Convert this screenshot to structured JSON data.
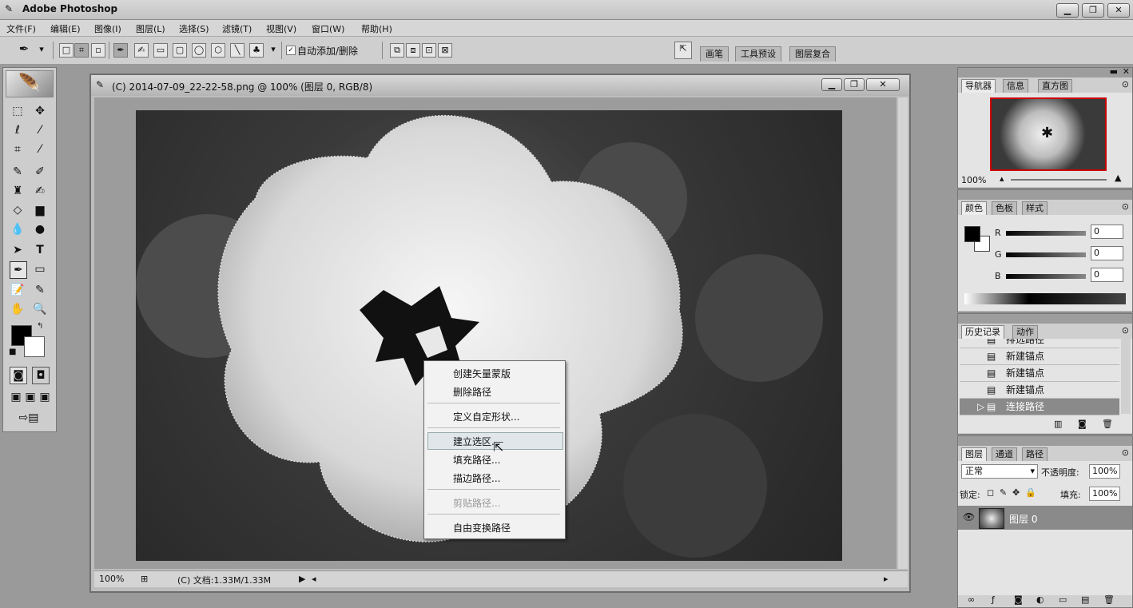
{
  "app": {
    "title": "Adobe Photoshop"
  },
  "window_buttons": {
    "minimize": "▁",
    "restore": "❐",
    "close": "✕"
  },
  "menu": [
    "文件(F)",
    "编辑(E)",
    "图像(I)",
    "图层(L)",
    "选择(S)",
    "滤镜(T)",
    "视图(V)",
    "窗口(W)",
    "帮助(H)"
  ],
  "options": {
    "auto_add_delete_label": "自动添加/删除",
    "auto_add_delete_checked": true,
    "well_tabs": [
      "画笔",
      "工具预设",
      "图层复合"
    ]
  },
  "document": {
    "title": "(C) 2014-07-09_22-22-58.png @ 100% (图层 0, RGB/8)",
    "zoom": "100%",
    "doc_info": "(C) 文档:1.33M/1.33M"
  },
  "context_menu": {
    "items": [
      "创建矢量蒙版",
      "删除路径",
      "定义自定形状...",
      "建立选区...",
      "填充路径...",
      "描边路径...",
      "剪贴路径...",
      "自由变换路径"
    ],
    "highlighted": "建立选区...",
    "disabled": "剪贴路径..."
  },
  "navigator": {
    "tabs": [
      "导航器",
      "信息",
      "直方图"
    ],
    "zoom": "100%"
  },
  "color_panel": {
    "tabs": [
      "颜色",
      "色板",
      "样式"
    ],
    "channels": [
      {
        "label": "R",
        "value": "0"
      },
      {
        "label": "G",
        "value": "0"
      },
      {
        "label": "B",
        "value": "0"
      }
    ]
  },
  "history_panel": {
    "tabs": [
      "历史记录",
      "动作"
    ],
    "items": [
      "排选路径",
      "新建锚点",
      "新建锚点",
      "新建锚点",
      "连接路径"
    ],
    "selected_index": 4
  },
  "layers_panel": {
    "tabs": [
      "图层",
      "通道",
      "路径"
    ],
    "blend_mode": "正常",
    "opacity_label": "不透明度:",
    "opacity": "100%",
    "lock_label": "锁定:",
    "fill_label": "填充:",
    "fill": "100%",
    "layers": [
      {
        "name": "图层 0"
      }
    ]
  }
}
